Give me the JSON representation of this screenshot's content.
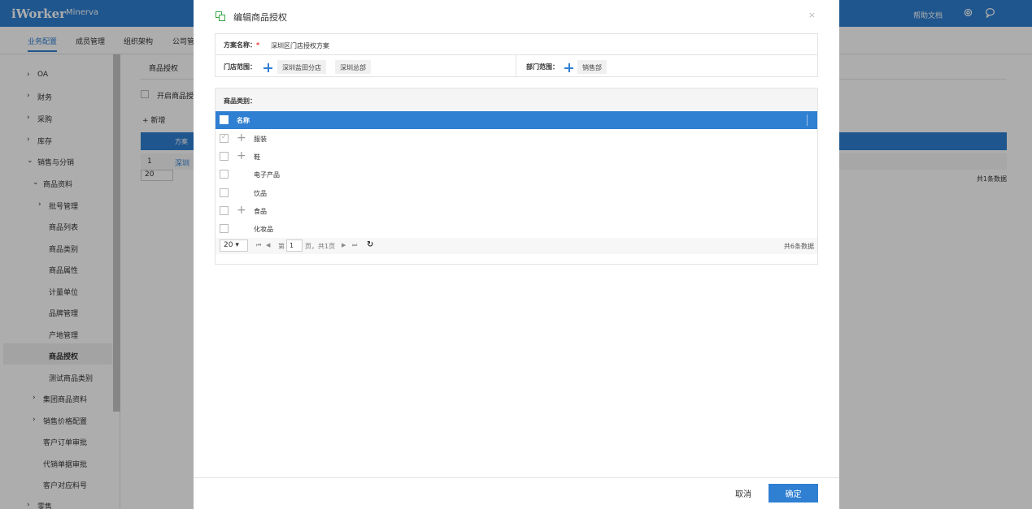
{
  "topbar": {
    "logo": "iWorker",
    "subtitle": "Minerva",
    "help": "帮助文档"
  },
  "navtabs": [
    "业务配置",
    "成员管理",
    "组织架构",
    "公司管"
  ],
  "sidebar": {
    "items": [
      {
        "label": "OA",
        "arrow": "›"
      },
      {
        "label": "财务",
        "arrow": "›"
      },
      {
        "label": "采购",
        "arrow": "›"
      },
      {
        "label": "库存",
        "arrow": "›"
      },
      {
        "label": "销售与分销",
        "arrow": "⌄"
      },
      {
        "label": "商品资料",
        "arrow": "⌄"
      },
      {
        "label": "批号管理",
        "arrow": "›"
      },
      {
        "label": "商品列表",
        "arrow": ""
      },
      {
        "label": "商品类别",
        "arrow": ""
      },
      {
        "label": "商品属性",
        "arrow": ""
      },
      {
        "label": "计量单位",
        "arrow": ""
      },
      {
        "label": "品牌管理",
        "arrow": ""
      },
      {
        "label": "产地管理",
        "arrow": ""
      },
      {
        "label": "商品授权",
        "arrow": ""
      },
      {
        "label": "测试商品类别",
        "arrow": ""
      },
      {
        "label": "集团商品资料",
        "arrow": "›"
      },
      {
        "label": "销售价格配置",
        "arrow": "›"
      },
      {
        "label": "客户订单审批",
        "arrow": ""
      },
      {
        "label": "代销单据审批",
        "arrow": ""
      },
      {
        "label": "客户对应料号",
        "arrow": ""
      },
      {
        "label": "零售",
        "arrow": "›"
      }
    ]
  },
  "background": {
    "title": "商品授权",
    "enable_label": "开启商品授",
    "add_label": "新增",
    "header_text": "方案",
    "row_num": "1",
    "row_text": "深圳",
    "page_size": "20",
    "total": "共1条数据"
  },
  "modal": {
    "title": "编辑商品授权",
    "close": "×",
    "scheme_label": "方案名称：",
    "required_mark": "*",
    "scheme_value": "深圳区门店授权方案",
    "store_label": "门店范围：",
    "stores": [
      "深圳盐田分店",
      "深圳总部"
    ],
    "dept_label": "部门范围：",
    "depts": [
      "销售部"
    ],
    "category_label": "商品类别：",
    "grid_header": "名称",
    "rows": [
      {
        "name": "服装",
        "expand": true,
        "checked": true
      },
      {
        "name": "鞋",
        "expand": true,
        "checked": false
      },
      {
        "name": "电子产品",
        "expand": false,
        "checked": false
      },
      {
        "name": "饮品",
        "expand": false,
        "checked": false
      },
      {
        "name": "食品",
        "expand": true,
        "checked": false
      },
      {
        "name": "化妆品",
        "expand": false,
        "checked": false
      }
    ],
    "pager": {
      "page_size": "20",
      "page_prefix": "第",
      "page_value": "1",
      "page_suffix": "页，共1页",
      "total": "共6条数据"
    },
    "cancel": "取消",
    "ok": "确定"
  }
}
